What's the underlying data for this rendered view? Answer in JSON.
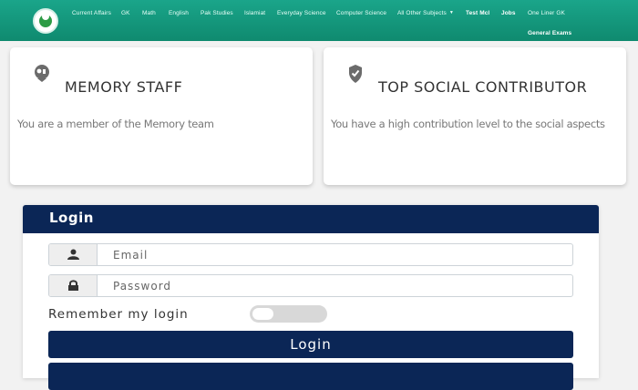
{
  "navbar": {
    "links": [
      {
        "label": "Current Affairs"
      },
      {
        "label": "GK"
      },
      {
        "label": "Math"
      },
      {
        "label": "English"
      },
      {
        "label": "Pak Studies"
      },
      {
        "label": "Islamiat"
      },
      {
        "label": "Everyday Science"
      },
      {
        "label": "Computer Science"
      },
      {
        "label": "All Other Subjects"
      },
      {
        "label": "Test Mcl"
      },
      {
        "label": "Jobs"
      },
      {
        "label": "One Liner GK"
      },
      {
        "label": "General Exams"
      }
    ],
    "caret": "▼",
    "color": "#14997d"
  },
  "cards": [
    {
      "title": "MEMORY STAFF",
      "description": "You are a member of the Memory team",
      "icon": "memory-badge-icon"
    },
    {
      "title": "TOP SOCIAL CONTRIBUTOR",
      "description": "You have a high contribution level to the social aspects",
      "icon": "shield-check-icon"
    }
  ],
  "login": {
    "title": "Login",
    "email_placeholder": "Email",
    "password_placeholder": "Password",
    "email_icon": "user-icon",
    "password_icon": "lock-icon",
    "remember_label": "Remember my login",
    "remember_checked": false,
    "button_label": "Login",
    "header_color": "#0b2656"
  }
}
